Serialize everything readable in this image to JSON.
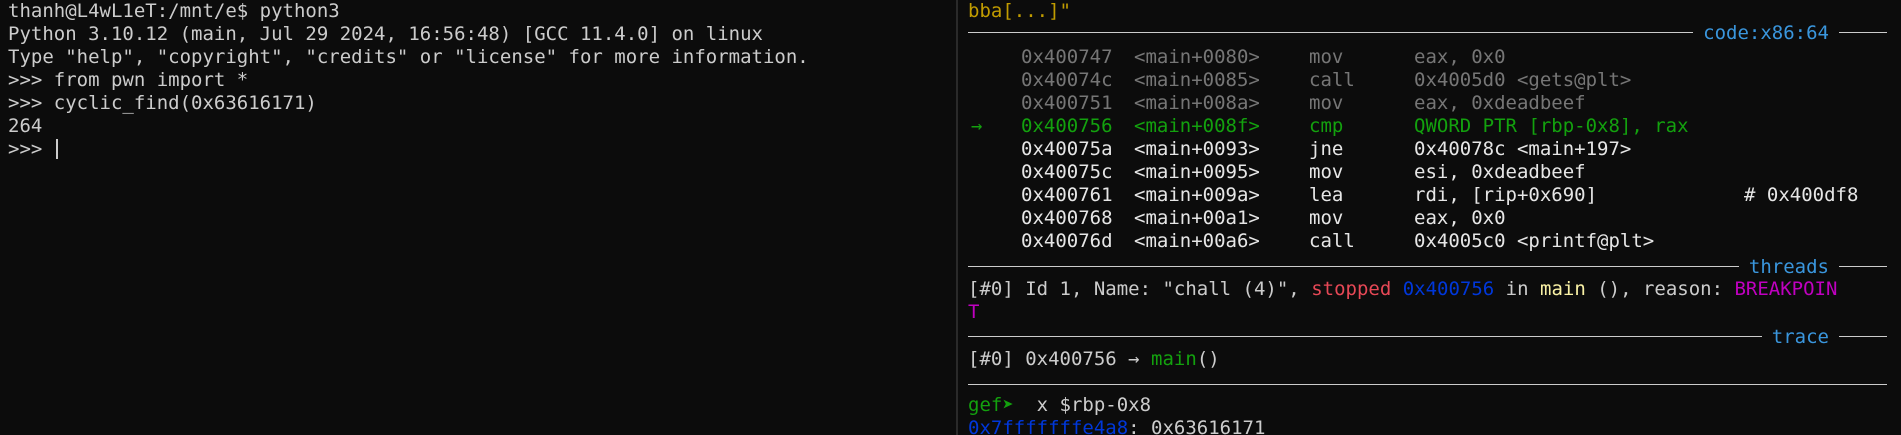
{
  "theme": {
    "background": "#0c0c0c",
    "foreground": "#cccccc",
    "dim": "#767676",
    "green": "#13a10e",
    "red": "#e74856",
    "blue": "#0037da",
    "cyan_title": "#3a96dd",
    "magenta": "#c000c0",
    "yellow": "#c19c00"
  },
  "left_terminal": {
    "prompt_line": "thanh@L4wL1eT:/mnt/e$ python3",
    "banner_1": "Python 3.10.12 (main, Jul 29 2024, 16:56:48) [GCC 11.4.0] on linux",
    "banner_2": "Type \"help\", \"copyright\", \"credits\" or \"license\" for more information.",
    "cmd_1": ">>> from pwn import *",
    "cmd_2": ">>> cyclic_find(0x63616171)",
    "result": "264",
    "prompt_current": ">>> "
  },
  "right_terminal": {
    "top_partial": "bba[...]\"",
    "code_section": {
      "title": "code:x86:64",
      "rows": [
        {
          "marker": "",
          "addr": "0x400747",
          "sym": "<main+0080>",
          "op": "mov",
          "args": "eax, 0x0",
          "comment": "",
          "state": "past"
        },
        {
          "marker": "",
          "addr": "0x40074c",
          "sym": "<main+0085>",
          "op": "call",
          "args": "0x4005d0 <gets@plt>",
          "comment": "",
          "state": "past"
        },
        {
          "marker": "",
          "addr": "0x400751",
          "sym": "<main+008a>",
          "op": "mov",
          "args": "eax, 0xdeadbeef",
          "comment": "",
          "state": "past"
        },
        {
          "marker": "→",
          "addr": "0x400756",
          "sym": "<main+008f>",
          "op": "cmp",
          "args": "QWORD PTR [rbp-0x8], rax",
          "comment": "",
          "state": "current"
        },
        {
          "marker": "",
          "addr": "0x40075a",
          "sym": "<main+0093>",
          "op": "jne",
          "args": "0x40078c <main+197>",
          "comment": "",
          "state": "future"
        },
        {
          "marker": "",
          "addr": "0x40075c",
          "sym": "<main+0095>",
          "op": "mov",
          "args": "esi, 0xdeadbeef",
          "comment": "",
          "state": "future"
        },
        {
          "marker": "",
          "addr": "0x400761",
          "sym": "<main+009a>",
          "op": "lea",
          "args": "rdi, [rip+0x690]",
          "comment": "# 0x400df8",
          "state": "future"
        },
        {
          "marker": "",
          "addr": "0x400768",
          "sym": "<main+00a1>",
          "op": "mov",
          "args": "eax, 0x0",
          "comment": "",
          "state": "future"
        },
        {
          "marker": "",
          "addr": "0x40076d",
          "sym": "<main+00a6>",
          "op": "call",
          "args": "0x4005c0 <printf@plt>",
          "comment": "",
          "state": "future"
        }
      ]
    },
    "threads_section": {
      "title": "threads",
      "thread_id": "[#0]",
      "pre": " Id 1, Name: \"chall (4)\", ",
      "status": "stopped",
      "addr": "0x400756",
      "in_word": " in ",
      "func": "main",
      "post": " (), reason: ",
      "reason_line1": "BREAKPOIN",
      "reason_line2": "T"
    },
    "trace_section": {
      "title": "trace",
      "frame_id": "[#0]",
      "addr": " 0x400756 → ",
      "func": "main",
      "suffix": "()"
    },
    "gef_prompt": "gef➤ ",
    "gef_command": " x $rbp-0x8",
    "mem_addr": "0x7fffffffe4a8",
    "mem_value": ": 0x63616171"
  }
}
